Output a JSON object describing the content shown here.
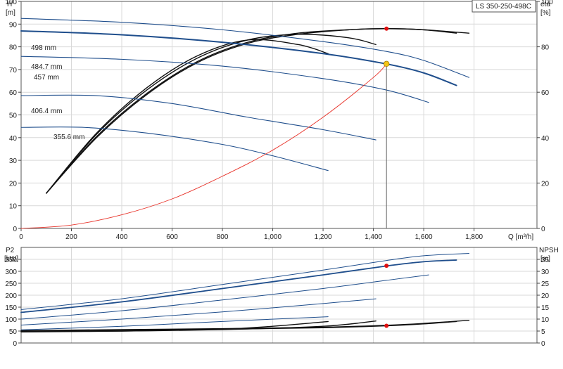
{
  "model_label": "LS 350-250-498C",
  "colors": {
    "head": "#1f4e8c",
    "eff": "#111111",
    "system": "#e8332a",
    "op_point": "#f5c518",
    "marker": "#e01010",
    "op_line": "#666666"
  },
  "chart_data": [
    {
      "type": "line",
      "title": "",
      "ylabel_left": "H",
      "ylabel_left_unit": "[m]",
      "ylabel_right": "eta",
      "ylabel_right_unit": "[%]",
      "xlabel": "Q [m³/h]",
      "xlim": [
        0,
        2050
      ],
      "ylim": [
        0,
        100
      ],
      "y_right_lim": [
        0,
        100
      ],
      "x_ticks": [
        "0",
        "200",
        "400",
        "600",
        "800",
        "1,000",
        "1,200",
        "1,400",
        "1,600",
        "1,800"
      ],
      "y_ticks": [
        "0",
        "10",
        "20",
        "30",
        "40",
        "50",
        "60",
        "70",
        "80",
        "90",
        "100"
      ],
      "y_right_ticks": [
        "0",
        "20",
        "40",
        "60",
        "80",
        "100"
      ],
      "grid": true,
      "series": [
        {
          "name": "498 mm",
          "x": [
            0,
            400,
            800,
            1200,
            1450,
            1600,
            1780
          ],
          "y": [
            92.5,
            90.8,
            87.5,
            82.3,
            78.0,
            74.0,
            66.5
          ]
        },
        {
          "name": "484.7 mm",
          "x": [
            0,
            400,
            800,
            1200,
            1450,
            1600,
            1730
          ],
          "y": [
            87.0,
            85.3,
            82.0,
            77.0,
            72.5,
            68.5,
            63.0
          ]
        },
        {
          "name": "457 mm",
          "x": [
            0,
            400,
            800,
            1200,
            1450,
            1620
          ],
          "y": [
            75.8,
            74.5,
            71.5,
            66.0,
            61.0,
            55.5
          ]
        },
        {
          "name": "406.4 mm",
          "x": [
            0,
            300,
            600,
            900,
            1200,
            1410
          ],
          "y": [
            58.5,
            58.5,
            55.0,
            49.0,
            43.5,
            39.0
          ]
        },
        {
          "name": "355.6 mm",
          "x": [
            0,
            250,
            500,
            800,
            1000,
            1220
          ],
          "y": [
            44.5,
            44.5,
            42.0,
            37.0,
            32.0,
            25.5
          ]
        }
      ],
      "efficiency_series": [
        {
          "x": [
            100,
            300,
            500,
            700,
            900,
            1100,
            1300,
            1450,
            1600,
            1780
          ],
          "y": [
            15.5,
            40.0,
            59.0,
            73.0,
            81.5,
            85.5,
            87.5,
            88.0,
            87.5,
            86.0
          ]
        },
        {
          "x": [
            100,
            300,
            500,
            700,
            900,
            1100,
            1300,
            1450,
            1600,
            1730
          ],
          "y": [
            15.5,
            40.5,
            59.5,
            73.5,
            82.0,
            86.0,
            87.5,
            88.0,
            87.5,
            86.0
          ]
        },
        {
          "x": [
            100,
            300,
            500,
            700,
            900,
            1100,
            1300,
            1410
          ],
          "y": [
            15.5,
            41.5,
            61.0,
            75.0,
            83.0,
            85.5,
            84.0,
            81.0
          ]
        },
        {
          "x": [
            100,
            300,
            500,
            700,
            900,
            1100,
            1220
          ],
          "y": [
            15.5,
            42.0,
            62.0,
            76.0,
            83.0,
            81.0,
            77.0
          ]
        }
      ],
      "system_curve": {
        "x": [
          0,
          200,
          400,
          600,
          800,
          1000,
          1200,
          1400,
          1452
        ],
        "y": [
          0,
          1.5,
          6.0,
          13.0,
          23.0,
          34.5,
          49.0,
          66.5,
          72.5
        ]
      },
      "operating_point": {
        "q": 1452,
        "h": 72.5,
        "eta": 88.0
      }
    },
    {
      "type": "line",
      "title": "",
      "ylabel_left": "P2",
      "ylabel_left_unit": "[kW]",
      "ylabel_right": "NPSH",
      "ylabel_right_unit": "[m]",
      "xlim": [
        0,
        2050
      ],
      "ylim": [
        0,
        400
      ],
      "y_right_lim": [
        0,
        40
      ],
      "y_ticks": [
        "0",
        "50",
        "100",
        "150",
        "200",
        "250",
        "300",
        "350"
      ],
      "y_right_ticks": [
        "0",
        "5",
        "10",
        "15",
        "20",
        "25",
        "30",
        "35"
      ],
      "grid": true,
      "power_series": [
        {
          "x": [
            0,
            400,
            800,
            1200,
            1450,
            1600,
            1780
          ],
          "y": [
            140,
            185,
            245,
            305,
            345,
            365,
            375
          ]
        },
        {
          "x": [
            0,
            400,
            800,
            1200,
            1450,
            1600,
            1730
          ],
          "y": [
            128,
            172,
            228,
            285,
            322,
            340,
            347
          ]
        },
        {
          "x": [
            0,
            400,
            800,
            1200,
            1450,
            1620
          ],
          "y": [
            100,
            135,
            180,
            228,
            262,
            285
          ]
        },
        {
          "x": [
            0,
            400,
            800,
            1200,
            1410
          ],
          "y": [
            75,
            100,
            130,
            165,
            185
          ]
        },
        {
          "x": [
            0,
            400,
            800,
            1220
          ],
          "y": [
            55,
            70,
            90,
            110
          ]
        }
      ],
      "npsh_series": [
        {
          "x": [
            0,
            400,
            800,
            1200,
            1450,
            1600,
            1780
          ],
          "y": [
            5.2,
            5.6,
            6.0,
            6.6,
            7.4,
            8.2,
            9.5
          ]
        },
        {
          "x": [
            0,
            400,
            800,
            1200,
            1450,
            1600,
            1730
          ],
          "y": [
            5.0,
            5.4,
            5.8,
            6.4,
            7.2,
            8.0,
            9.0
          ]
        },
        {
          "x": [
            0,
            400,
            800,
            1200,
            1410
          ],
          "y": [
            4.8,
            5.0,
            5.6,
            7.0,
            9.2
          ]
        },
        {
          "x": [
            0,
            400,
            800,
            1000,
            1220
          ],
          "y": [
            4.6,
            5.0,
            5.8,
            7.0,
            9.0
          ]
        }
      ],
      "operating_point": {
        "q": 1452,
        "p2": 323,
        "npsh": 7.2
      }
    }
  ]
}
